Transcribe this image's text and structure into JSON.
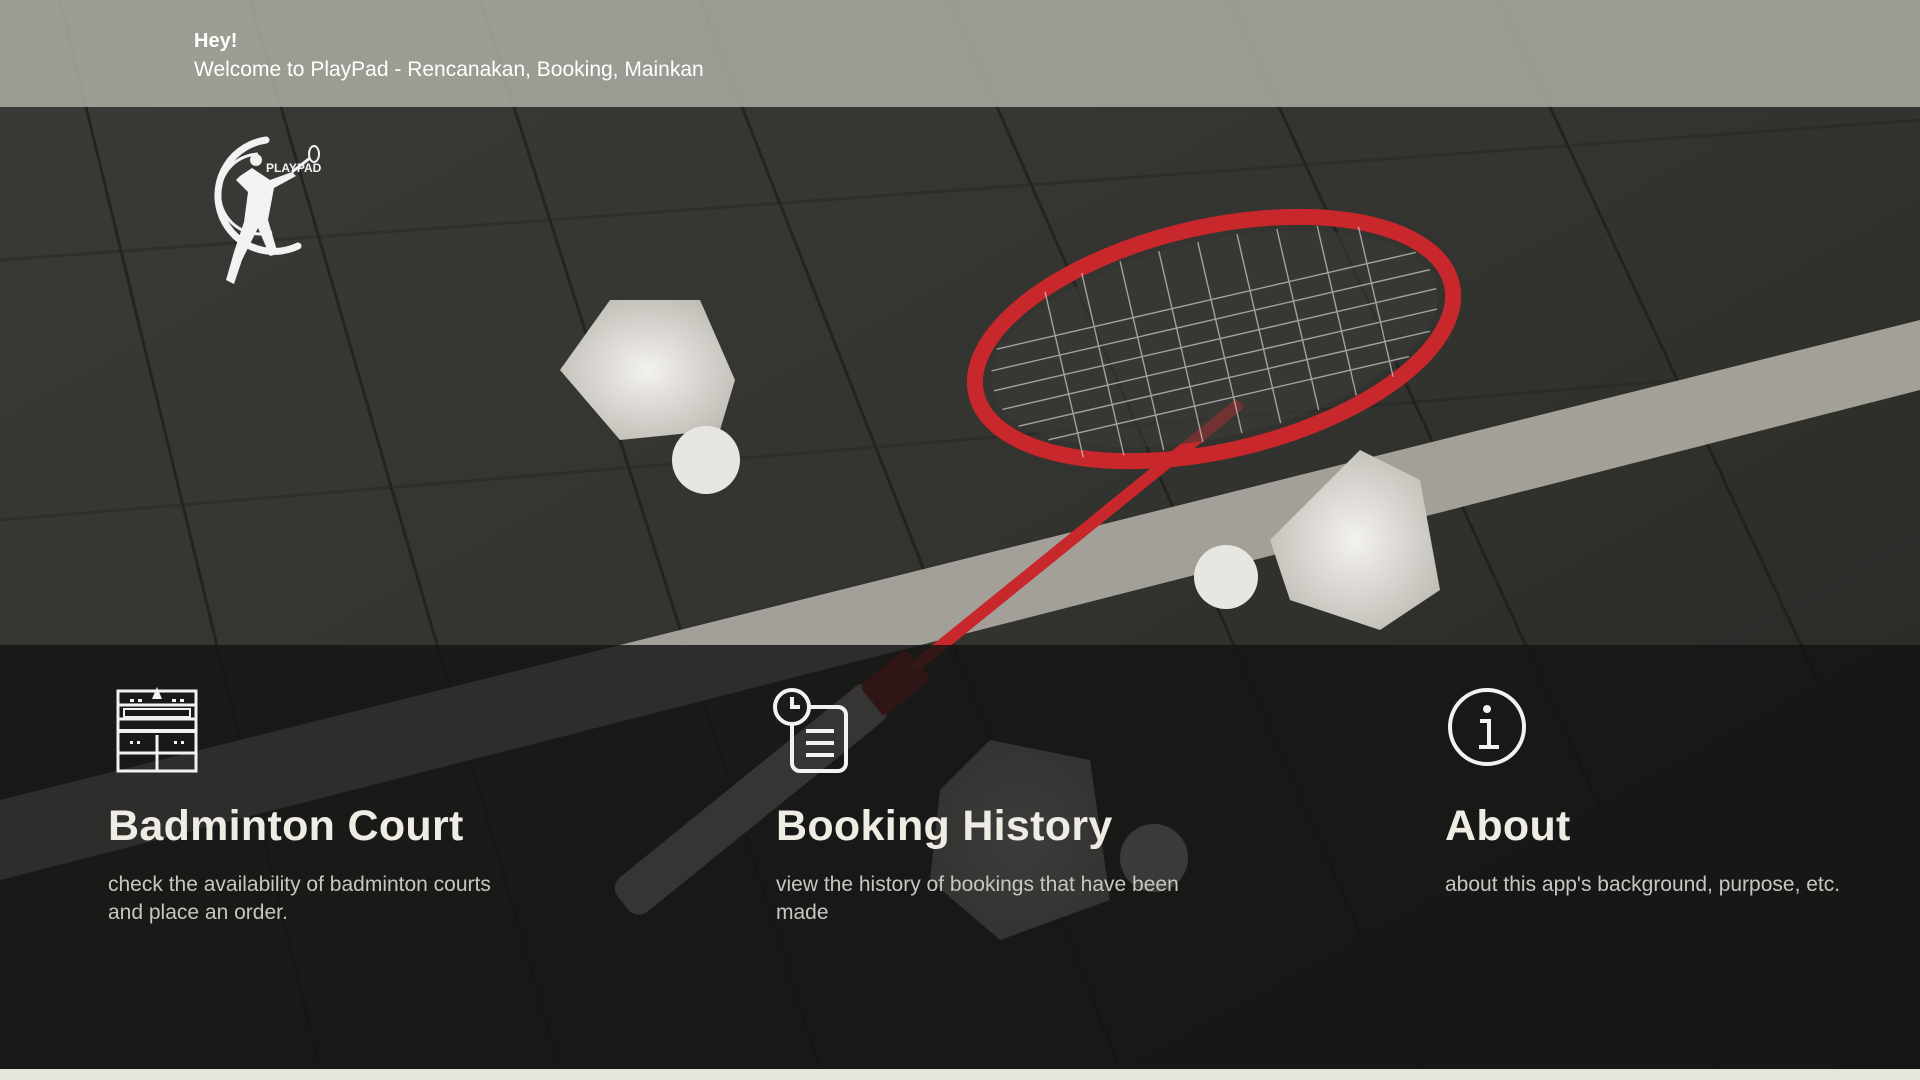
{
  "header": {
    "greeting": "Hey!",
    "welcome": "Welcome to PlayPad - Rencanakan, Booking, Mainkan"
  },
  "logo": {
    "text": "PLAYPAD",
    "icon": "badminton-player-logo"
  },
  "menu": [
    {
      "title": "Badminton Court",
      "description": "check the availability of badminton courts and place an order.",
      "icon": "badminton-court-icon"
    },
    {
      "title": "Booking History",
      "description": "view the history of bookings that have been made",
      "icon": "clock-document-icon"
    },
    {
      "title": "About",
      "description": "about this app's background, purpose, etc.",
      "icon": "info-icon"
    }
  ],
  "colors": {
    "banner": "#aaaaa0",
    "panel": "#141414",
    "title": "#efece4",
    "description": "#c9c6bf",
    "racket": "#c8272b"
  }
}
